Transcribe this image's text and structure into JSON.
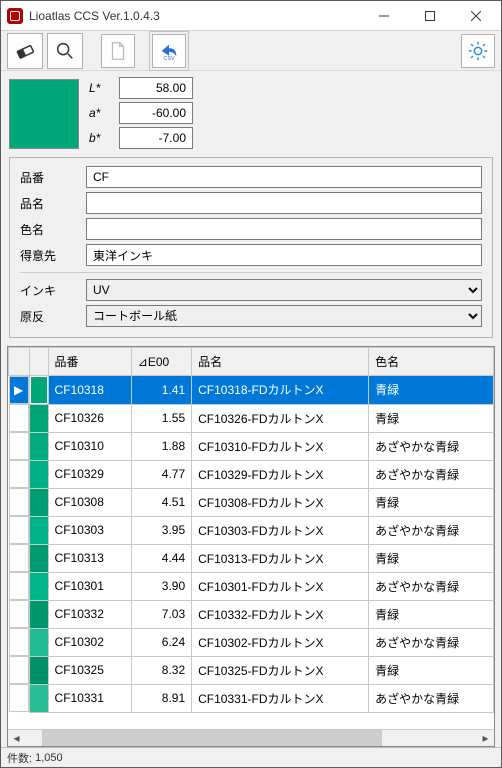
{
  "window": {
    "title": "Lioatlas CCS Ver.1.0.4.3"
  },
  "swatch_color": "#00a879",
  "lab": {
    "L_label": "L*",
    "L": "58.00",
    "a_label": "a*",
    "a": "-60.00",
    "b_label": "b*",
    "b": "-7.00"
  },
  "form": {
    "part_no_label": "品番",
    "part_no": "CF",
    "name_label": "品名",
    "name": "",
    "color_name_label": "色名",
    "color_name": "",
    "customer_label": "得意先",
    "customer": "東洋インキ",
    "ink_label": "インキ",
    "ink": "UV",
    "substrate_label": "原反",
    "substrate": "コートボール紙"
  },
  "columns": {
    "part_no": "品番",
    "de": "⊿E00",
    "name": "品名",
    "color": "色名"
  },
  "rows": [
    {
      "sel": true,
      "sw": "#00a879",
      "pn": "CF10318",
      "de": "1.41",
      "nm": "CF10318-FDカルトンX",
      "cn": "青緑"
    },
    {
      "sel": false,
      "sw": "#00a576",
      "pn": "CF10326",
      "de": "1.55",
      "nm": "CF10326-FDカルトンX",
      "cn": "青緑"
    },
    {
      "sel": false,
      "sw": "#00ab7e",
      "pn": "CF10310",
      "de": "1.88",
      "nm": "CF10310-FDカルトンX",
      "cn": "あざやかな青緑"
    },
    {
      "sel": false,
      "sw": "#00b087",
      "pn": "CF10329",
      "de": "4.77",
      "nm": "CF10329-FDカルトンX",
      "cn": "あざやかな青緑"
    },
    {
      "sel": false,
      "sw": "#009c72",
      "pn": "CF10308",
      "de": "4.51",
      "nm": "CF10308-FDカルトンX",
      "cn": "青緑"
    },
    {
      "sel": false,
      "sw": "#00b28a",
      "pn": "CF10303",
      "de": "3.95",
      "nm": "CF10303-FDカルトンX",
      "cn": "あざやかな青緑"
    },
    {
      "sel": false,
      "sw": "#009a70",
      "pn": "CF10313",
      "de": "4.44",
      "nm": "CF10313-FDカルトンX",
      "cn": "青緑"
    },
    {
      "sel": false,
      "sw": "#00b48c",
      "pn": "CF10301",
      "de": "3.90",
      "nm": "CF10301-FDカルトンX",
      "cn": "あざやかな青緑"
    },
    {
      "sel": false,
      "sw": "#00966c",
      "pn": "CF10332",
      "de": "7.03",
      "nm": "CF10332-FDカルトンX",
      "cn": "青緑"
    },
    {
      "sel": false,
      "sw": "#20bb93",
      "pn": "CF10302",
      "de": "6.24",
      "nm": "CF10302-FDカルトンX",
      "cn": "あざやかな青緑"
    },
    {
      "sel": false,
      "sw": "#009068",
      "pn": "CF10325",
      "de": "8.32",
      "nm": "CF10325-FDカルトンX",
      "cn": "青緑"
    },
    {
      "sel": false,
      "sw": "#2bbf97",
      "pn": "CF10331",
      "de": "8.91",
      "nm": "CF10331-FDカルトンX",
      "cn": "あざやかな青緑"
    }
  ],
  "status": {
    "count_label": "件数:",
    "count": "1,050"
  }
}
